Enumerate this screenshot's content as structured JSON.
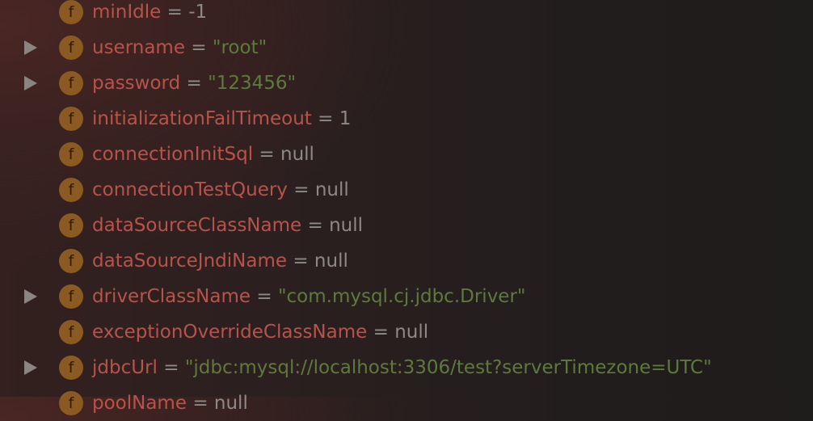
{
  "variables": [
    {
      "name": "minIdle",
      "value": "-1",
      "type": "num",
      "expandable": false
    },
    {
      "name": "username",
      "value": "\"root\"",
      "type": "str",
      "expandable": true
    },
    {
      "name": "password",
      "value": "\"123456\"",
      "type": "str",
      "expandable": true
    },
    {
      "name": "initializationFailTimeout",
      "value": "1",
      "type": "num",
      "expandable": false
    },
    {
      "name": "connectionInitSql",
      "value": "null",
      "type": "nul",
      "expandable": false
    },
    {
      "name": "connectionTestQuery",
      "value": "null",
      "type": "nul",
      "expandable": false
    },
    {
      "name": "dataSourceClassName",
      "value": "null",
      "type": "nul",
      "expandable": false
    },
    {
      "name": "dataSourceJndiName",
      "value": "null",
      "type": "nul",
      "expandable": false
    },
    {
      "name": "driverClassName",
      "value": "\"com.mysql.cj.jdbc.Driver\"",
      "type": "str",
      "expandable": true
    },
    {
      "name": "exceptionOverrideClassName",
      "value": "null",
      "type": "nul",
      "expandable": false
    },
    {
      "name": "jdbcUrl",
      "value": "\"jdbc:mysql://localhost:3306/test?serverTimezone=UTC\"",
      "type": "str",
      "expandable": true
    },
    {
      "name": "poolName",
      "value": "null",
      "type": "nul",
      "expandable": false
    }
  ],
  "icon_letter": "f",
  "equals": "="
}
